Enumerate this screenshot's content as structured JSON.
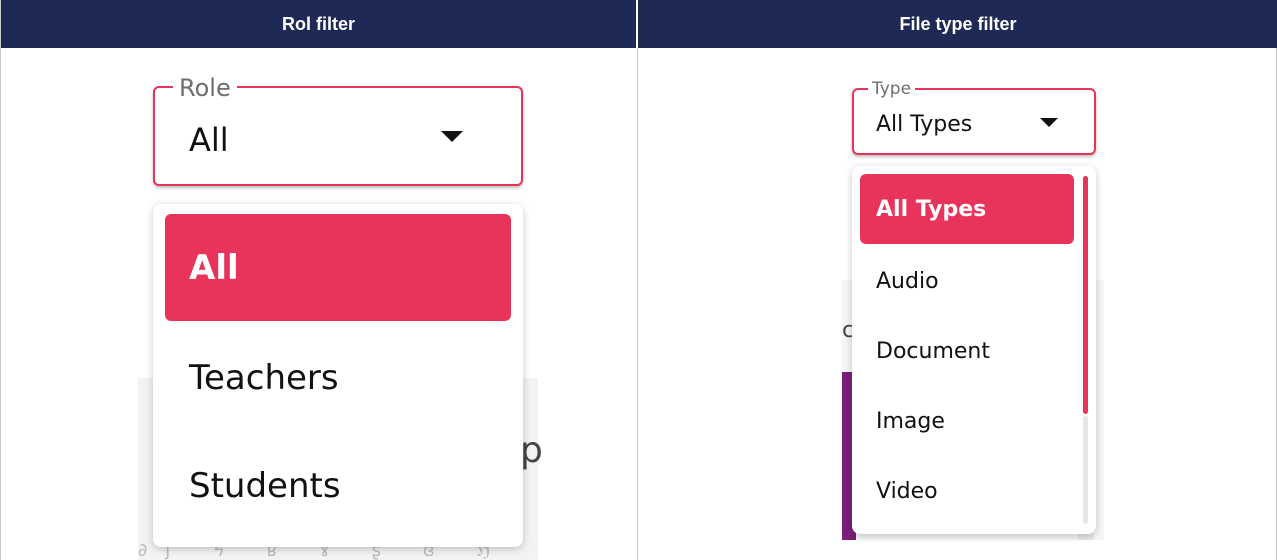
{
  "headers": {
    "left": "Rol filter",
    "right": "File type filter"
  },
  "role_filter": {
    "label": "Role",
    "value": "All",
    "options": [
      "All",
      "Teachers",
      "Students"
    ],
    "selected_index": 0
  },
  "type_filter": {
    "label": "Type",
    "value": "All Types",
    "options": [
      "All Types",
      "Audio",
      "Document",
      "Image",
      "Video"
    ],
    "selected_index": 0
  },
  "background": {
    "left_partial_letter": "p",
    "right_partial_letter": "c"
  },
  "colors": {
    "header_bg": "#1e2a55",
    "accent": "#e8345a",
    "background_purple": "#7a1f7a"
  },
  "icons": {
    "dropdown": "caret-down-icon"
  }
}
